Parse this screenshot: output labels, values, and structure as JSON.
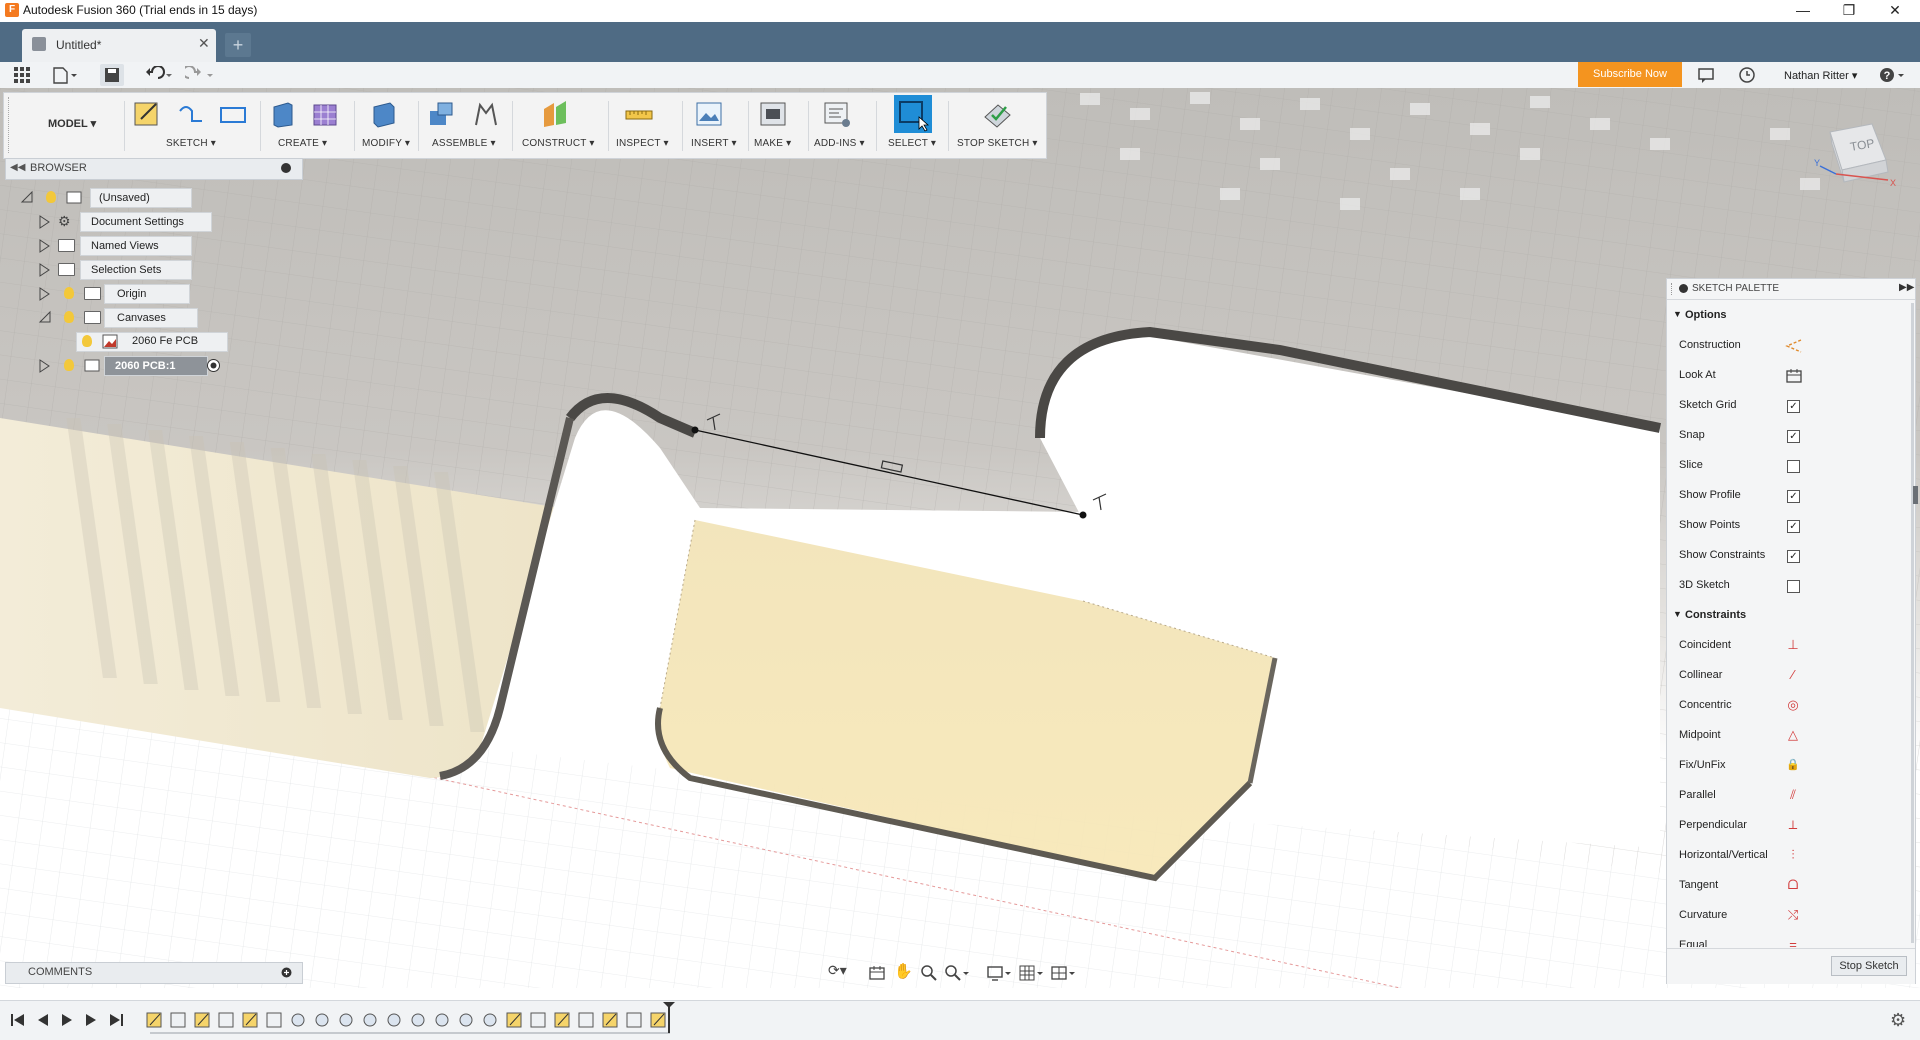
{
  "window": {
    "title": "Autodesk Fusion 360 (Trial ends in 15 days)",
    "app_icon_letter": "F",
    "controls": [
      "minimize",
      "restore",
      "close"
    ]
  },
  "tabs": {
    "document_tab": "Untitled*",
    "new_tab_icon": "plus-icon"
  },
  "appbar": {
    "subscribe_label": "Subscribe Now",
    "user_name": "Nathan Ritter",
    "help_icon": "help-icon"
  },
  "toolbar": {
    "workspace": "MODEL",
    "groups": [
      "SKETCH",
      "CREATE",
      "MODIFY",
      "ASSEMBLE",
      "CONSTRUCT",
      "INSPECT",
      "INSERT",
      "MAKE",
      "ADD-INS",
      "SELECT",
      "STOP SKETCH"
    ]
  },
  "browser": {
    "title": "BROWSER",
    "items": [
      {
        "label": "(Unsaved)",
        "expanded": true
      },
      {
        "label": "Document Settings"
      },
      {
        "label": "Named Views"
      },
      {
        "label": "Selection Sets"
      },
      {
        "label": "Origin"
      },
      {
        "label": "Canvases",
        "expanded": true
      },
      {
        "label": "2060 Fe PCB"
      },
      {
        "label": "2060 PCB:1",
        "active": true
      }
    ]
  },
  "viewcube": {
    "face_label": "TOP",
    "axis_x": "X",
    "axis_y": "Y"
  },
  "palette": {
    "title": "SKETCH PALETTE",
    "options_header": "Options",
    "options": [
      {
        "label": "Construction",
        "icon": "construction-icon"
      },
      {
        "label": "Look At",
        "icon": "look-at-icon"
      },
      {
        "label": "Sketch Grid",
        "checked": true
      },
      {
        "label": "Snap",
        "checked": true
      },
      {
        "label": "Slice",
        "checked": false
      },
      {
        "label": "Show Profile",
        "checked": true
      },
      {
        "label": "Show Points",
        "checked": true
      },
      {
        "label": "Show Constraints",
        "checked": true
      },
      {
        "label": "3D Sketch",
        "checked": false
      }
    ],
    "constraints_header": "Constraints",
    "constraints": [
      {
        "label": "Coincident",
        "icon": "coincident-icon",
        "glyph": "⊥"
      },
      {
        "label": "Collinear",
        "icon": "collinear-icon",
        "glyph": "⁄"
      },
      {
        "label": "Concentric",
        "icon": "concentric-icon",
        "glyph": "◎"
      },
      {
        "label": "Midpoint",
        "icon": "midpoint-icon",
        "glyph": "△"
      },
      {
        "label": "Fix/UnFix",
        "icon": "lock-icon",
        "glyph": "🔒"
      },
      {
        "label": "Parallel",
        "icon": "parallel-icon",
        "glyph": "⫽"
      },
      {
        "label": "Perpendicular",
        "icon": "perpendicular-icon",
        "glyph": "⟂"
      },
      {
        "label": "Horizontal/Vertical",
        "icon": "horizontal-vertical-icon",
        "glyph": "⫶"
      },
      {
        "label": "Tangent",
        "icon": "tangent-icon",
        "glyph": "ᗝ"
      },
      {
        "label": "Curvature",
        "icon": "curvature-icon",
        "glyph": "⤭"
      },
      {
        "label": "Equal",
        "icon": "equal-icon",
        "glyph": "="
      }
    ],
    "stop_sketch_label": "Stop Sketch"
  },
  "comments": {
    "title": "COMMENTS"
  },
  "colors": {
    "tab_strip": "#4f6b84",
    "subscribe": "#f4941f",
    "selection_blue": "#1f8dd6",
    "profile_fill": "#f3dfa0",
    "accent_red": "#d23c3c"
  }
}
